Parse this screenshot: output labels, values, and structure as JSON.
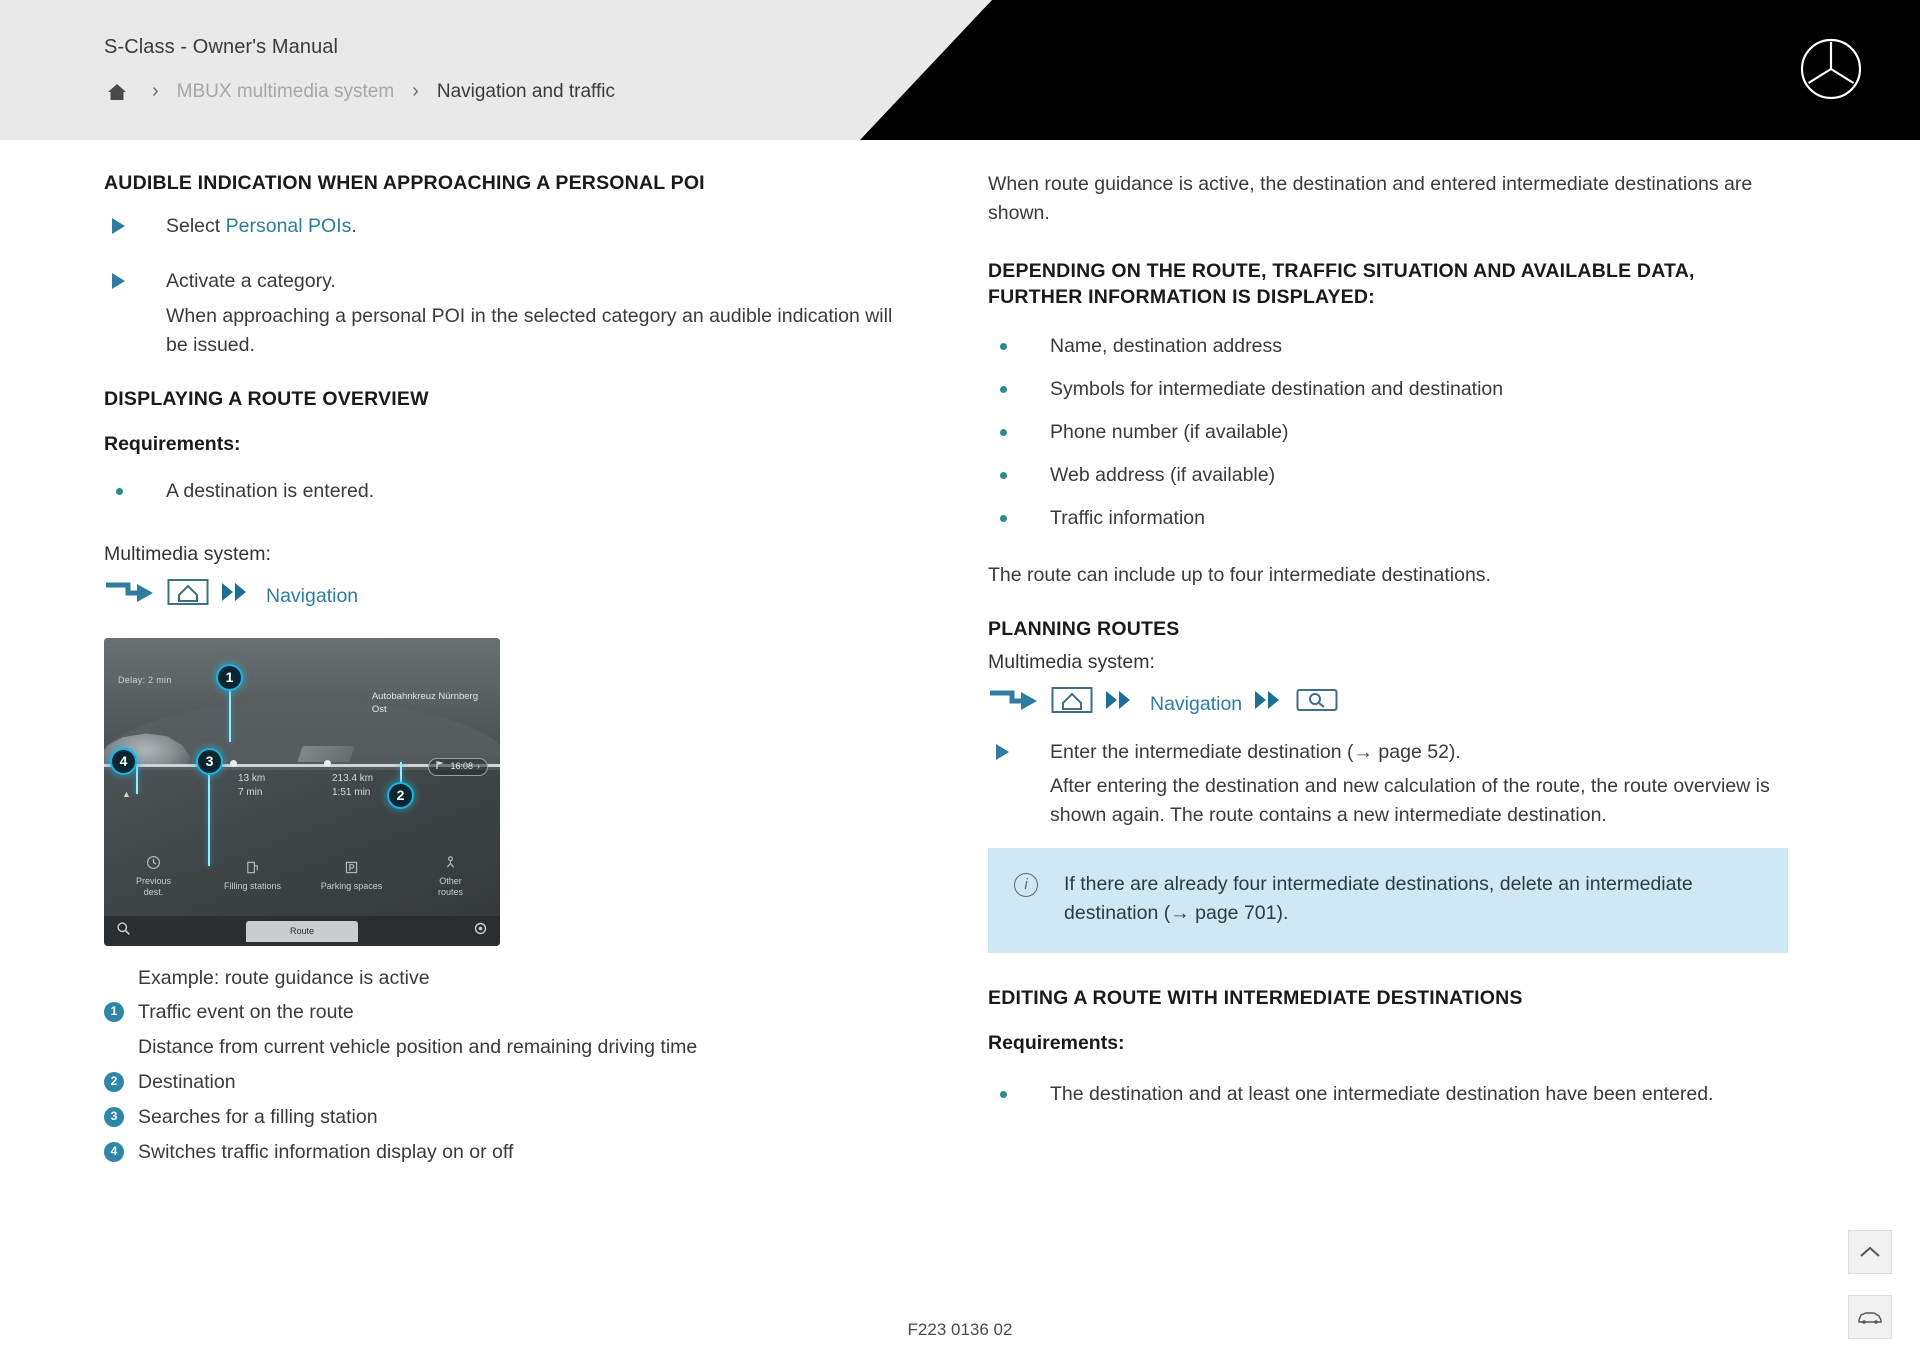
{
  "header": {
    "manual_title": "S-Class - Owner's Manual",
    "breadcrumb": {
      "home_icon": "home-icon",
      "separator": "›",
      "parent": "MBUX multimedia system",
      "current": "Navigation and traffic"
    },
    "brand_logo": "mercedes-star-logo"
  },
  "left_column": {
    "heading_audible": "AUDIBLE INDICATION WHEN APPROACHING A PERSONAL POI",
    "step1_prefix": "Select ",
    "step1_link": "Personal POIs",
    "step1_suffix": ".",
    "step2": "Activate a category.",
    "step2_note": "When approaching a personal POI in the selected category an audible indication will be issued.",
    "heading_overview": "DISPLAYING A ROUTE OVERVIEW",
    "requirements_label": "Requirements:",
    "requirement_1": "A destination is entered.",
    "multimedia_label": "Multimedia system:",
    "icon_path": {
      "arrow_icon": "turn-arrow-icon",
      "home_icon": "home-screen-icon",
      "chevron_icon": "double-chevron-icon",
      "label": "Navigation"
    },
    "screenshot": {
      "delay": "Delay: 2 min",
      "poi_line1": "Autobahnkreuz Nürnberg",
      "poi_line2": "Ost",
      "segment1_distance": "13 km",
      "segment1_time": "7 min",
      "segment2_distance": "213.4 km",
      "segment2_time": "1:51 min",
      "eta": "16:08",
      "toolbar": [
        {
          "icon": "history-icon",
          "label": "Previous\ndest."
        },
        {
          "icon": "fuel-pump-icon",
          "label": "Filling stations"
        },
        {
          "icon": "parking-icon",
          "label": "Parking spaces"
        },
        {
          "icon": "alternate-routes-icon",
          "label": "Other\nroutes"
        }
      ],
      "bottom_bar": {
        "search_icon": "search-icon",
        "tab_label": "Route",
        "settings_icon": "gear-icon"
      },
      "callouts": [
        "1",
        "2",
        "3",
        "4"
      ]
    },
    "legend": {
      "title": "Example: route guidance is active",
      "items": [
        {
          "num": "1",
          "text": "Traffic event on the route"
        },
        {
          "num": "",
          "text": "Distance from current vehicle position and remaining driving time"
        },
        {
          "num": "2",
          "text": "Destination"
        },
        {
          "num": "3",
          "text": "Searches for a filling station"
        },
        {
          "num": "4",
          "text": "Switches traffic information display on or off"
        }
      ]
    }
  },
  "right_column": {
    "intro": "When route guidance is active, the destination and entered intermediate destinations are shown.",
    "heading_depending": "DEPENDING ON THE ROUTE, TRAFFIC SITUATION AND AVAILABLE DATA, FURTHER INFORMATION IS DISPLAYED:",
    "bullets": [
      "Name, destination address",
      "Symbols for intermediate destination and destination",
      "Phone number (if available)",
      "Web address (if available)",
      "Traffic information"
    ],
    "route_note": "The route can include up to four intermediate destinations.",
    "heading_planning": "PLANNING ROUTES",
    "multimedia_label": "Multimedia system:",
    "icon_path": {
      "arrow_icon": "turn-arrow-icon",
      "home_icon": "home-screen-icon",
      "chevron_icon": "double-chevron-icon",
      "label": "Navigation",
      "chevron_icon_2": "double-chevron-icon",
      "search_icon": "search-box-icon"
    },
    "step_enter": "Enter the intermediate destination (→ page 52).",
    "step_enter_note": "After entering the destination and new calculation of the route, the route overview is shown again. The route contains a new intermediate destination.",
    "info_box": {
      "icon": "info-icon",
      "text": "If there are already four intermediate destinations, delete an intermediate destination (→ page 701)."
    },
    "heading_editing": "EDITING A ROUTE WITH INTERMEDIATE DESTINATIONS",
    "requirements_label": "Requirements:",
    "requirement_1": "The destination and at least one intermediate destination have been entered."
  },
  "controls": {
    "scroll_top_icon": "chevron-up-icon",
    "vehicle_icon": "vehicle-icon"
  },
  "footer": {
    "document_code": "F223 0136 02"
  },
  "colors": {
    "accent": "#2e7d9e",
    "bullet": "#2f8a8a",
    "info_bg": "#cfe8f5",
    "callout": "#16b4e0",
    "header_bg": "#e9e9e9"
  }
}
